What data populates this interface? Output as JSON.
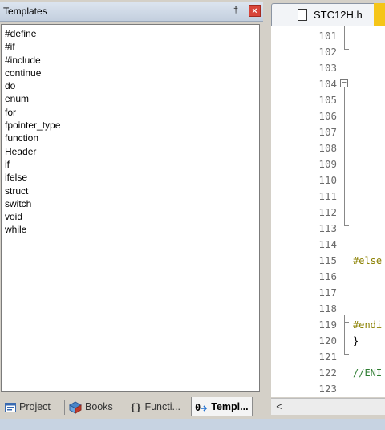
{
  "templates_panel": {
    "title": "Templates",
    "pin_glyph": "†",
    "close_glyph": "×",
    "items": [
      "#define",
      "#if",
      "#include",
      "continue",
      "do",
      "enum",
      "for",
      "fpointer_type",
      "function",
      "Header",
      "if",
      "ifelse",
      "struct",
      "switch",
      "void",
      "while"
    ]
  },
  "bottom_tabs": [
    {
      "label": "Project",
      "icon": "project-icon"
    },
    {
      "label": "Books",
      "icon": "books-icon"
    },
    {
      "label": "Functi...",
      "icon": "functions-icon",
      "glyph": "{}"
    },
    {
      "label": "Templ...",
      "icon": "templates-icon",
      "glyph": "0"
    }
  ],
  "editor": {
    "file_tab": "STC12H.h",
    "lines": [
      {
        "n": "101",
        "code": ""
      },
      {
        "n": "102",
        "code": ""
      },
      {
        "n": "103",
        "code": ""
      },
      {
        "n": "104",
        "code": ""
      },
      {
        "n": "105",
        "code": ""
      },
      {
        "n": "106",
        "code": ""
      },
      {
        "n": "107",
        "code": ""
      },
      {
        "n": "108",
        "code": ""
      },
      {
        "n": "109",
        "code": ""
      },
      {
        "n": "110",
        "code": ""
      },
      {
        "n": "111",
        "code": ""
      },
      {
        "n": "112",
        "code": ""
      },
      {
        "n": "113",
        "code": ""
      },
      {
        "n": "114",
        "code": ""
      },
      {
        "n": "115",
        "code": "#else"
      },
      {
        "n": "116",
        "code": ""
      },
      {
        "n": "117",
        "code": ""
      },
      {
        "n": "118",
        "code": ""
      },
      {
        "n": "119",
        "code": "#endi"
      },
      {
        "n": "120",
        "code": "}"
      },
      {
        "n": "121",
        "code": ""
      },
      {
        "n": "122",
        "code": "//ENI"
      },
      {
        "n": "123",
        "code": ""
      }
    ],
    "scroll_left_glyph": "<"
  },
  "colors": {
    "preprocessor": "#8b8000",
    "comment": "#2e7d32",
    "line_number": "#6b6b6b"
  }
}
